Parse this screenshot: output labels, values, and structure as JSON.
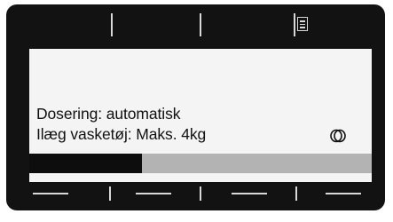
{
  "display": {
    "line1": "Dosering: automatisk",
    "line2": "Ilæg vasketøj: Maks. 4kg",
    "status_icon": "double-ring-icon",
    "menu_icon": "menu-list-icon"
  },
  "progress": {
    "fraction": 0.33
  },
  "colors": {
    "bezel": "#121212",
    "screen": "#f4f4f4",
    "progress_fill": "#0d0d0d",
    "progress_track": "#b3b3b3"
  }
}
